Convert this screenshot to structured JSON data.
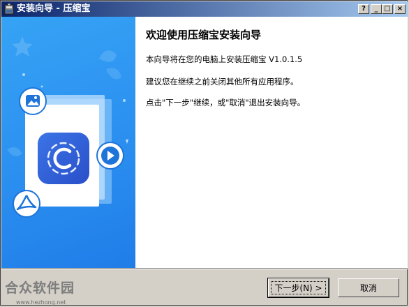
{
  "window": {
    "title": "安装向导 - 压缩宝",
    "buttons": {
      "help": "?",
      "minimize": "_",
      "maximize": "□",
      "close": "×"
    }
  },
  "page": {
    "heading": "欢迎使用压缩宝安装向导",
    "line1": "本向导将在您的电脑上安装压缩宝 V1.0.1.5",
    "line2": "建议您在继续之前关闭其他所有应用程序。",
    "line3": "点击\"下一步\"继续，或\"取消\"退出安装向导。"
  },
  "footer": {
    "brand": "合众软件园",
    "url": "www.hezhong.net",
    "next_label": "下一步(N) >",
    "cancel_label": "取消"
  },
  "colors": {
    "titlebar": "#0a246a",
    "banner": "#2b8ff0",
    "app_icon": "#2f62d8"
  },
  "icons": [
    "installer-icon",
    "image-icon",
    "play-icon",
    "pdf-icon",
    "app-logo-icon",
    "star-icon"
  ]
}
